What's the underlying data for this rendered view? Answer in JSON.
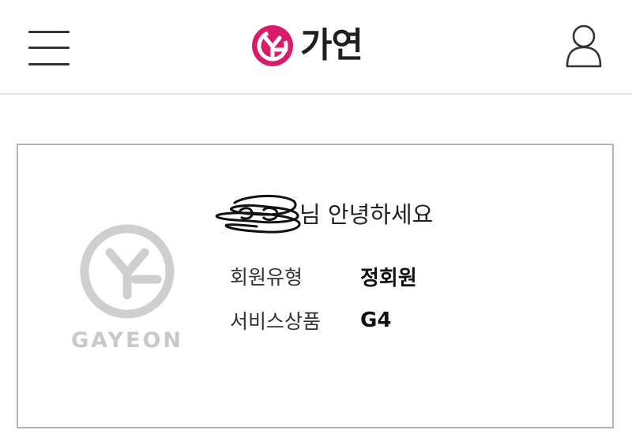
{
  "header": {
    "brand_name": "가연",
    "brand_color": "#d81b6b"
  },
  "card": {
    "watermark_text": "GAYEON",
    "greeting": "님 안녕하세요",
    "rows": [
      {
        "label": "회원유형",
        "value": "정회원"
      },
      {
        "label": "서비스상품",
        "value": "G4"
      }
    ]
  }
}
